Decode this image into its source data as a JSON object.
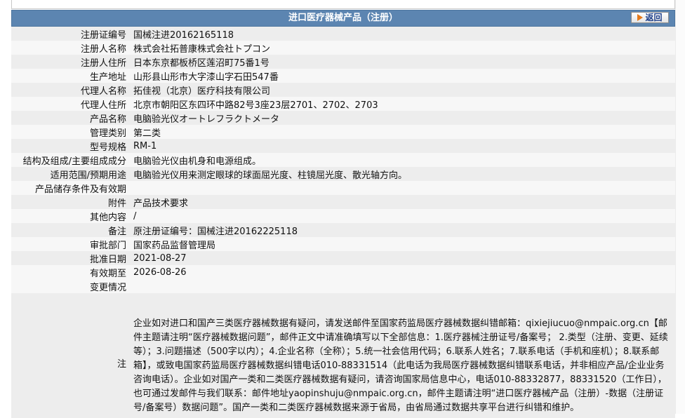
{
  "header": {
    "title": "进口医疗器械产品（注册）",
    "back_label": "返回"
  },
  "rows": [
    {
      "label": "注册证编号",
      "value": "国械注进20162165118"
    },
    {
      "label": "注册人名称",
      "value": "株式会社拓普康株式会社トプコン"
    },
    {
      "label": "注册人住所",
      "value": "日本东京都板桥区莲沼町75番1号"
    },
    {
      "label": "生产地址",
      "value": "山形县山形市大字漆山字石田547番"
    },
    {
      "label": "代理人名称",
      "value": "拓佳视（北京）医疗科技有限公司"
    },
    {
      "label": "代理人住所",
      "value": "北京市朝阳区东四环中路82号3座23层2701、2702、2703"
    },
    {
      "label": "产品名称",
      "value": "电脑验光仪オートレフラクトメータ"
    },
    {
      "label": "管理类别",
      "value": "第二类"
    },
    {
      "label": "型号规格",
      "value": "RM-1"
    },
    {
      "label": "结构及组成/主要组成成分",
      "value": "电脑验光仪由机身和电源组成。"
    },
    {
      "label": "适用范围/预期用途",
      "value": "电脑验光仪用来测定眼球的球面屈光度、柱镜屈光度、散光轴方向。"
    },
    {
      "label": "产品储存条件及有效期",
      "value": ""
    },
    {
      "label": "附件",
      "value": "产品技术要求"
    },
    {
      "label": "其他内容",
      "value": "/"
    },
    {
      "label": "备注",
      "value": "原注册证编号：国械注进20162225118"
    },
    {
      "label": "审批部门",
      "value": "国家药品监督管理局"
    },
    {
      "label": "批准日期",
      "value": "2021-08-27"
    },
    {
      "label": "有效期至",
      "value": "2026-08-26"
    }
  ],
  "changes": {
    "label": "变更情况",
    "value": ""
  },
  "notice": {
    "label": "注",
    "text": "企业如对进口和国产三类医疗器械数据有疑问，请发送邮件至国家药监局医疗器械数据纠错邮箱：qixiejiucuo@nmpaic.org.cn【邮件主题请注明“医疗器械数据问题”，邮件正文中请准确填写以下全部信息：1.医疗器械注册证号/备案号； 2.类型（注册、变更、延续等）；3.问题描述（500字以内）；4.企业名称（全称）；5.统一社会信用代码；6.联系人姓名；7.联系电话（手机和座机）；8.联系邮箱】，或致电国家药监局医疗器械数据纠错电话010-88331514（此电话为我局医疗器械数据纠错联系电话，并非相应产品/企业业务咨询电话）。企业如对国产一类和二类医疗器械数据有疑问，请咨询国家局信息中心，电话010-88332877，88331520（工作日），也可通过发邮件与我们联系：邮件地址yaopinshuju@nmpaic.org.cn，邮件主题请注明“进口医疗器械产品（注册）-数据（注册证号/备案号）数据问题”。国产一类和二类医疗器械数据来源于省局，由省局通过数据共享平台进行纠错和维护。"
  }
}
